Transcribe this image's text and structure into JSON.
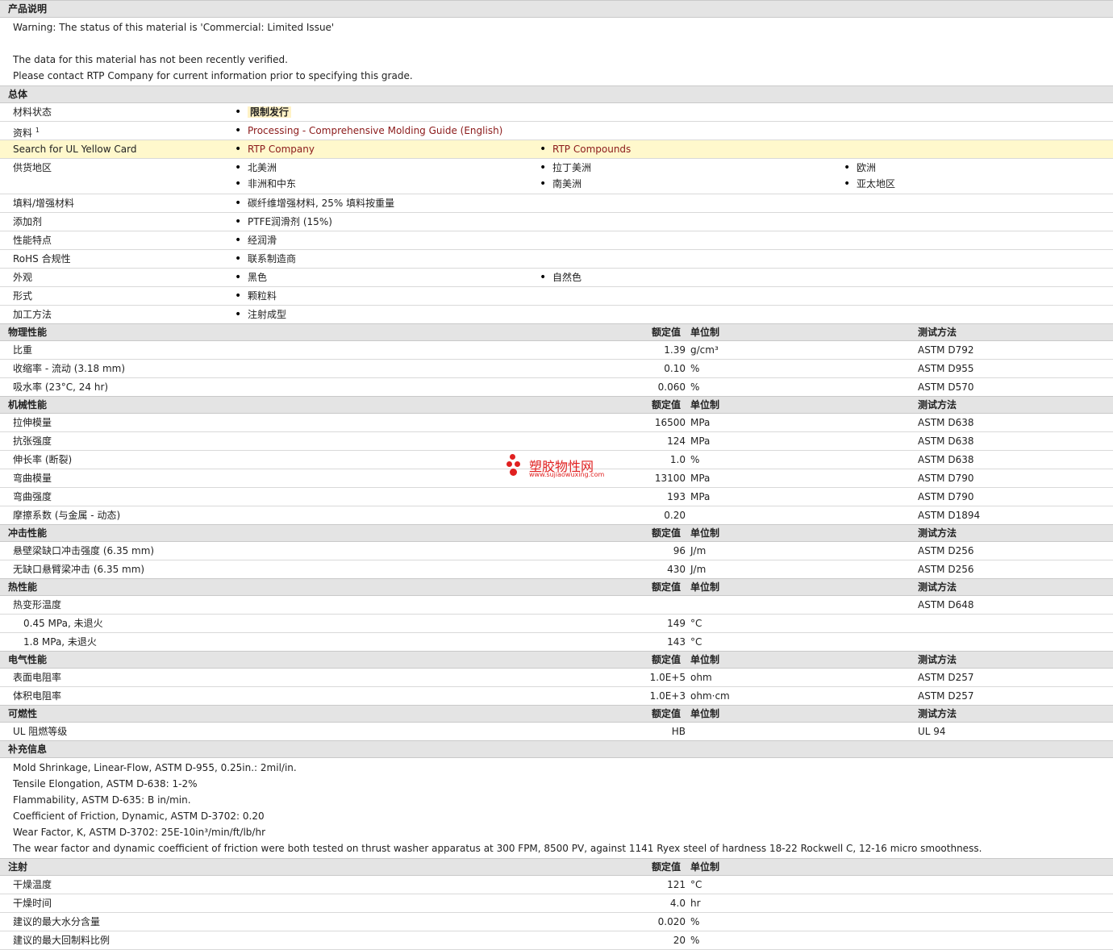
{
  "desc": {
    "title": "产品说明",
    "lines": [
      "Warning: The status of this material is 'Commercial: Limited Issue'",
      "",
      "The data for this material has not been recently verified.",
      "Please contact RTP Company for current information prior to specifying this grade."
    ]
  },
  "general": {
    "title": "总体",
    "status_label": "材料状态",
    "status_value": "限制发行",
    "docs_label": "资料",
    "docs_sup": "1",
    "docs_link": "Processing - Comprehensive Molding Guide (English)",
    "ul_label": "Search for UL Yellow Card",
    "ul_link1": "RTP Company",
    "ul_link2": "RTP Compounds",
    "supply_label": "供货地区",
    "supply": [
      "北美洲",
      "拉丁美洲",
      "欧洲",
      "非洲和中东",
      "南美洲",
      "亚太地区"
    ],
    "filler_label": "填料/增强材料",
    "filler_value": "碳纤维增强材料, 25% 填料按重量",
    "additive_label": "添加剂",
    "additive_value": "PTFE润滑剂 (15%)",
    "feature_label": "性能特点",
    "feature_value": "经润滑",
    "rohs_label": "RoHS 合规性",
    "rohs_value": "联系制造商",
    "appearance_label": "外观",
    "appearance1": "黑色",
    "appearance2": "自然色",
    "form_label": "形式",
    "form_value": "颗粒料",
    "process_label": "加工方法",
    "process_value": "注射成型"
  },
  "col": {
    "value": "额定值",
    "unit": "单位制",
    "test": "测试方法"
  },
  "physical": {
    "title": "物理性能",
    "rows": [
      {
        "label": "比重",
        "value": "1.39",
        "unit": "g/cm³",
        "test": "ASTM D792"
      },
      {
        "label": "收缩率 - 流动 (3.18 mm)",
        "value": "0.10",
        "unit": "%",
        "test": "ASTM D955"
      },
      {
        "label": "吸水率 (23°C, 24 hr)",
        "value": "0.060",
        "unit": "%",
        "test": "ASTM D570"
      }
    ]
  },
  "mechanical": {
    "title": "机械性能",
    "rows": [
      {
        "label": "拉伸模量",
        "value": "16500",
        "unit": "MPa",
        "test": "ASTM D638"
      },
      {
        "label": "抗张强度",
        "value": "124",
        "unit": "MPa",
        "test": "ASTM D638"
      },
      {
        "label": "伸长率 (断裂)",
        "value": "1.0",
        "unit": "%",
        "test": "ASTM D638"
      },
      {
        "label": "弯曲模量",
        "value": "13100",
        "unit": "MPa",
        "test": "ASTM D790"
      },
      {
        "label": "弯曲强度",
        "value": "193",
        "unit": "MPa",
        "test": "ASTM D790"
      },
      {
        "label": "摩擦系数 (与金属 - 动态)",
        "value": "0.20",
        "unit": "",
        "test": "ASTM D1894"
      }
    ]
  },
  "impact": {
    "title": "冲击性能",
    "rows": [
      {
        "label": "悬壁梁缺口冲击强度 (6.35 mm)",
        "value": "96",
        "unit": "J/m",
        "test": "ASTM D256"
      },
      {
        "label": "无缺口悬臂梁冲击 (6.35 mm)",
        "value": "430",
        "unit": "J/m",
        "test": "ASTM D256"
      }
    ]
  },
  "thermal": {
    "title": "热性能",
    "hdt_label": "热变形温度",
    "hdt_test": "ASTM D648",
    "rows": [
      {
        "label": "0.45 MPa, 未退火",
        "value": "149",
        "unit": "°C"
      },
      {
        "label": "1.8 MPa, 未退火",
        "value": "143",
        "unit": "°C"
      }
    ]
  },
  "electrical": {
    "title": "电气性能",
    "rows": [
      {
        "label": "表面电阻率",
        "value": "1.0E+5",
        "unit": "ohm",
        "test": "ASTM D257"
      },
      {
        "label": "体积电阻率",
        "value": "1.0E+3",
        "unit": "ohm·cm",
        "test": "ASTM D257"
      }
    ]
  },
  "flammability": {
    "title": "可燃性",
    "rows": [
      {
        "label": "UL 阻燃等级",
        "value": "HB",
        "unit": "",
        "test": "UL 94"
      }
    ]
  },
  "supplement": {
    "title": "补充信息",
    "lines": [
      "Mold Shrinkage, Linear-Flow, ASTM D-955, 0.25in.: 2mil/in.",
      "Tensile Elongation, ASTM D-638: 1-2%",
      "Flammability, ASTM D-635: B in/min.",
      "Coefficient of Friction, Dynamic, ASTM D-3702: 0.20",
      "Wear Factor, K, ASTM D-3702: 25E-10in³/min/ft/lb/hr",
      "The wear factor and dynamic coefficient of friction were both tested on thrust washer apparatus at 300 FPM, 8500 PV, against 1141 Ryex steel of hardness 18-22 Rockwell C, 12-16 micro smoothness."
    ]
  },
  "injection": {
    "title": "注射",
    "rows": [
      {
        "label": "干燥温度",
        "value": "121",
        "unit": "°C"
      },
      {
        "label": "干燥时间",
        "value": "4.0",
        "unit": "hr"
      },
      {
        "label": "建议的最大水分含量",
        "value": "0.020",
        "unit": "%"
      },
      {
        "label": "建议的最大回制料比例",
        "value": "20",
        "unit": "%"
      }
    ]
  },
  "watermark": {
    "name": "塑胶物性网",
    "url": "www.sujiaowuxing.com"
  }
}
